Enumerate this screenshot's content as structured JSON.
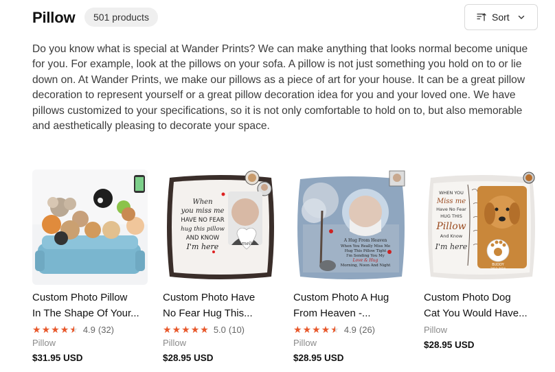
{
  "header": {
    "title": "Pillow",
    "count": "501 products",
    "sort_label": "Sort"
  },
  "description": "Do you know what is special at Wander Prints? We can make anything that looks normal become unique for you. For example, look at the pillows on your sofa. A pillow is not just something you hold on to or lie down on. At Wander Prints, we make our pillows as a piece of art for your house. It can be a great pillow decoration to represent yourself or a great pillow decoration idea for you and your loved one. We have pillows customized to your specifications, so it is not only comfortable to hold on to, but also memorable and aesthetically pleasing to decorate your space.",
  "products": [
    {
      "name_line1": "Custom Photo Pillow",
      "name_line2": "In The Shape Of Your...",
      "stars": 4.5,
      "rating": "4.9",
      "reviews": "(32)",
      "category": "Pillow",
      "price": "$31.95 USD"
    },
    {
      "name_line1": "Custom Photo Have",
      "name_line2": "No Fear Hug This...",
      "stars": 5,
      "rating": "5.0",
      "reviews": "(10)",
      "category": "Pillow",
      "price": "$28.95 USD",
      "pillow_text": [
        "When",
        "you miss me",
        "HAVE NO FEAR",
        "hug this pillow",
        "AND KNOW",
        "I'm here"
      ],
      "name_tag": "Amelia"
    },
    {
      "name_line1": "Custom Photo A Hug",
      "name_line2": "From Heaven -...",
      "stars": 4.5,
      "rating": "4.9",
      "reviews": "(26)",
      "category": "Pillow",
      "price": "$28.95 USD",
      "pillow_text": [
        "A Hug From Heaven",
        "When You Really Miss Me",
        "Hug This Pillow Tight",
        "I'm Sending You My",
        "Love & Hug",
        "Morning, Noon And Night"
      ]
    },
    {
      "name_line1": "Custom Photo Dog",
      "name_line2": "Cat You Would Have...",
      "stars": null,
      "category": "Pillow",
      "price": "$28.95 USD",
      "pillow_text": [
        "WHEN YOU",
        "Miss me",
        "Have No Fear",
        "HUG THIS",
        "Pillow",
        "And Know",
        "I'm here"
      ],
      "pet_tag": [
        "BUDDY",
        "2012-2024"
      ]
    }
  ],
  "colors": {
    "star": "#e8582b",
    "badge_bg": "#efefef",
    "price": "#111111",
    "category": "#8a8a8a"
  }
}
